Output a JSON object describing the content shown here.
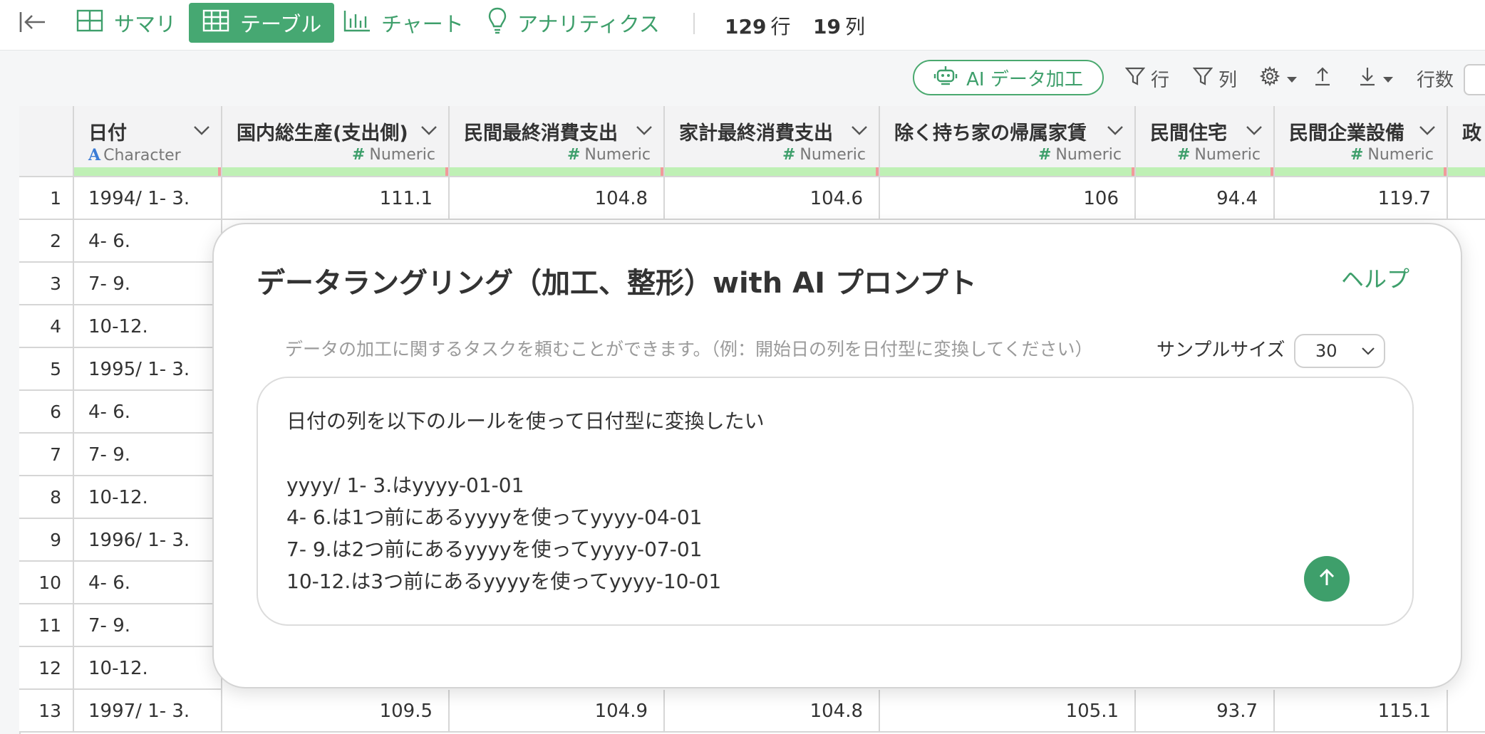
{
  "toolbar": {
    "tabs": [
      {
        "label": "サマリ",
        "icon": "grid-icon"
      },
      {
        "label": "テーブル",
        "icon": "table-icon",
        "active": true
      },
      {
        "label": "チャート",
        "icon": "bar-chart-icon"
      },
      {
        "label": "アナリティクス",
        "icon": "lightbulb-icon"
      }
    ],
    "rows_count": "129",
    "rows_unit": "行",
    "cols_count": "19",
    "cols_unit": "列"
  },
  "subtoolbar": {
    "ai_button": "AI データ加工",
    "row_filter": "行",
    "col_filter": "列",
    "rows_label": "行数"
  },
  "columns": [
    {
      "name": "日付",
      "type": "Character"
    },
    {
      "name": "国内総生産(支出側)",
      "type": "Numeric"
    },
    {
      "name": "民間最終消費支出",
      "type": "Numeric"
    },
    {
      "name": "家計最終消費支出",
      "type": "Numeric"
    },
    {
      "name": "除く持ち家の帰属家賃",
      "type": "Numeric"
    },
    {
      "name": "民間住宅",
      "type": "Numeric"
    },
    {
      "name": "民間企業設備",
      "type": "Numeric"
    },
    {
      "name": "政",
      "type": ""
    }
  ],
  "rows": [
    {
      "n": "1",
      "cells": [
        "1994/ 1- 3.",
        "111.1",
        "104.8",
        "104.6",
        "106",
        "94.4",
        "119.7"
      ]
    },
    {
      "n": "2",
      "cells": [
        "4- 6."
      ]
    },
    {
      "n": "3",
      "cells": [
        "7- 9."
      ]
    },
    {
      "n": "4",
      "cells": [
        "10-12."
      ]
    },
    {
      "n": "5",
      "cells": [
        "1995/ 1- 3."
      ]
    },
    {
      "n": "6",
      "cells": [
        "4- 6."
      ]
    },
    {
      "n": "7",
      "cells": [
        "7- 9."
      ]
    },
    {
      "n": "8",
      "cells": [
        "10-12."
      ]
    },
    {
      "n": "9",
      "cells": [
        "1996/ 1- 3."
      ]
    },
    {
      "n": "10",
      "cells": [
        "4- 6."
      ]
    },
    {
      "n": "11",
      "cells": [
        "7- 9."
      ]
    },
    {
      "n": "12",
      "cells": [
        "10-12."
      ]
    },
    {
      "n": "13",
      "cells": [
        "1997/ 1- 3.",
        "109.5",
        "104.9",
        "104.8",
        "105.1",
        "93.7",
        "115.1"
      ]
    }
  ],
  "modal": {
    "title": "データラングリング（加工、整形）with AI プロンプト",
    "help": "ヘルプ",
    "hint": "データの加工に関するタスクを頼むことができます。（例：開始日の列を日付型に変換してください）",
    "sample_label": "サンプルサイズ",
    "sample_value": "30",
    "prompt": "日付の列を以下のルールを使って日付型に変換したい\n\nyyyy/ 1- 3.はyyyy-01-01\n4- 6.は1つ前にあるyyyyを使ってyyyy-04-01\n7- 9.は2つ前にあるyyyyを使ってyyyy-07-01\n10-12.は3つ前にあるyyyyを使ってyyyy-10-01"
  },
  "colors": {
    "accent": "#3e9f6b",
    "type_bar": "#bff0b5"
  }
}
